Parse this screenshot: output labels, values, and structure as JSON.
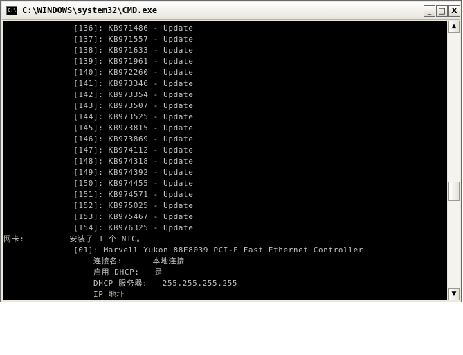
{
  "window": {
    "title": "C:\\WINDOWS\\system32\\CMD.exe",
    "icon_label": "C:\\",
    "minimize_label": "_",
    "maximize_label": "□",
    "close_label": "X"
  },
  "console": {
    "lines": [
      "              [136]: KB971486 - Update",
      "              [137]: KB971557 - Update",
      "              [138]: KB971633 - Update",
      "              [139]: KB971961 - Update",
      "              [140]: KB972260 - Update",
      "              [141]: KB973346 - Update",
      "              [142]: KB973354 - Update",
      "              [143]: KB973507 - Update",
      "              [144]: KB973525 - Update",
      "              [145]: KB973815 - Update",
      "              [146]: KB973869 - Update",
      "              [147]: KB974112 - Update",
      "              [148]: KB974318 - Update",
      "              [149]: KB974392 - Update",
      "              [150]: KB974455 - Update",
      "              [151]: KB974571 - Update",
      "              [152]: KB975025 - Update",
      "              [153]: KB975467 - Update",
      "              [154]: KB976325 - Update",
      "网卡:         安装了 1 个 NIC。",
      "              [01]: Marvell Yukon 88E8039 PCI-E Fast Ethernet Controller",
      "                  连接名:      本地连接",
      "                  启用 DHCP:   是",
      "                  DHCP 服务器:   255.255.255.255",
      "                  IP 地址"
    ]
  },
  "scrollbar": {
    "up_arrow": "▲",
    "down_arrow": "▼"
  }
}
